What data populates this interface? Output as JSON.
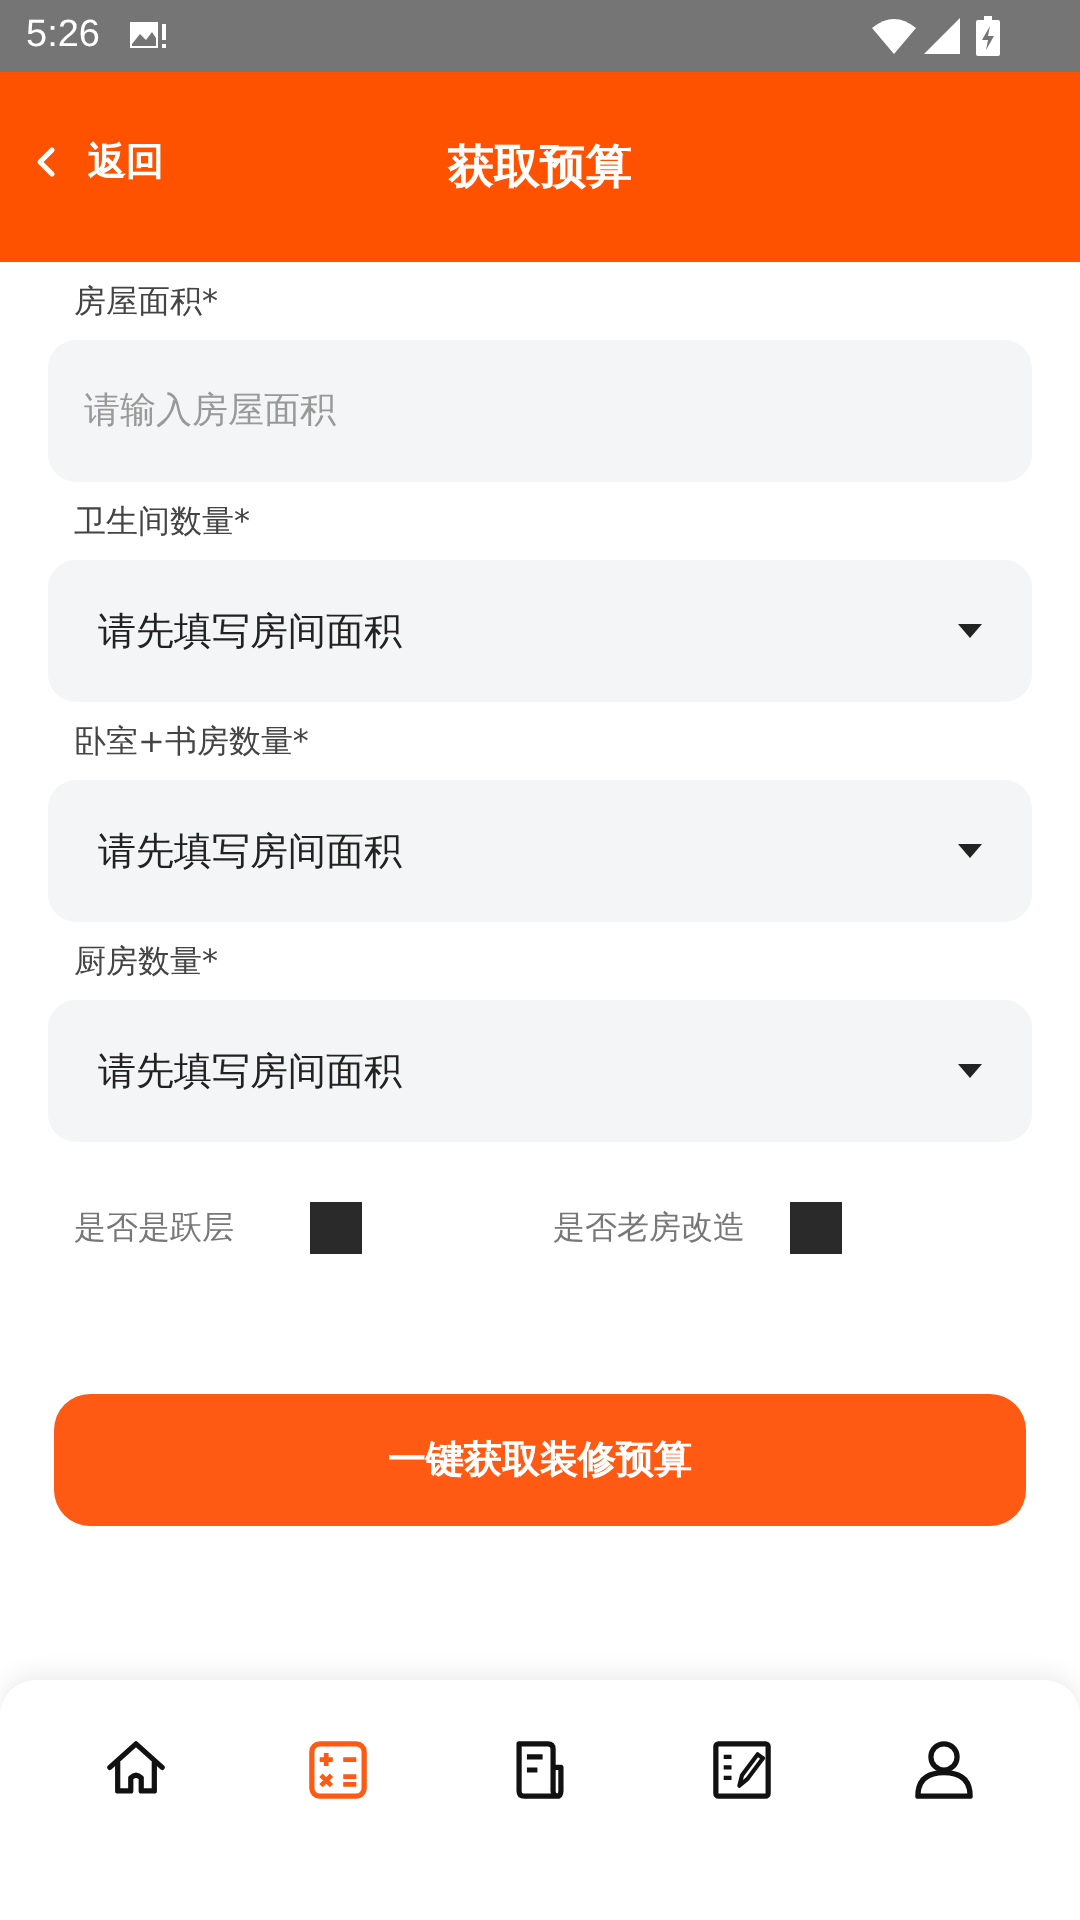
{
  "status_bar": {
    "time": "5:26"
  },
  "header": {
    "back_label": "返回",
    "title": "获取预算"
  },
  "fields": [
    {
      "kind": "input",
      "label": "房屋面积*",
      "placeholder": "请输入房屋面积"
    },
    {
      "kind": "select",
      "label": "卫生间数量*",
      "value": "请先填写房间面积"
    },
    {
      "kind": "select",
      "label": "卧室+书房数量*",
      "value": "请先填写房间面积"
    },
    {
      "kind": "select",
      "label": "厨房数量*",
      "value": "请先填写房间面积"
    }
  ],
  "checkboxes": [
    {
      "label": "是否是跃层",
      "checked": false
    },
    {
      "label": "是否老房改造",
      "checked": false
    }
  ],
  "submit_button": "一键获取装修预算",
  "nav": [
    {
      "kind": "home",
      "selected": false
    },
    {
      "kind": "calculator",
      "selected": true
    },
    {
      "kind": "document",
      "selected": false
    },
    {
      "kind": "note",
      "selected": false
    },
    {
      "kind": "profile",
      "selected": false
    }
  ]
}
